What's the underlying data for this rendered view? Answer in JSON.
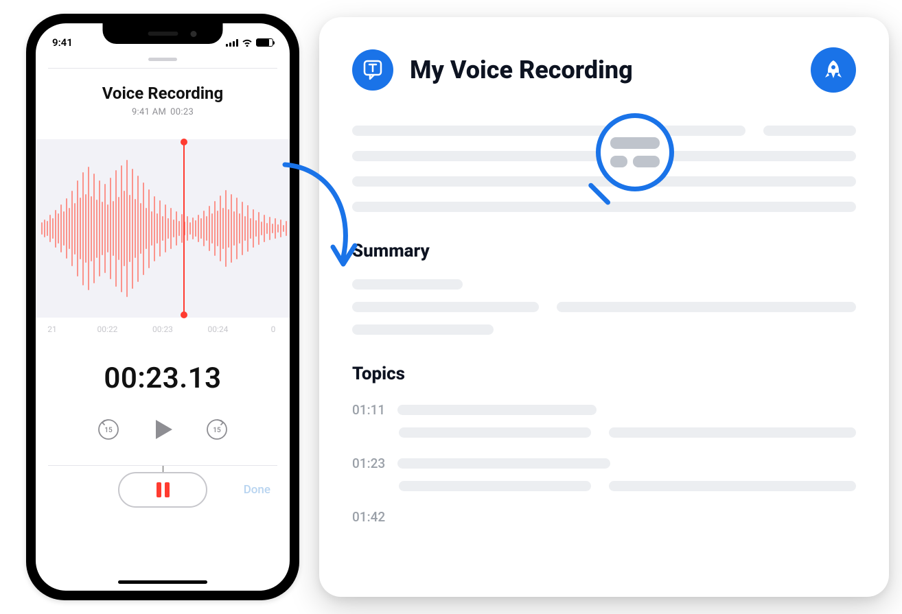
{
  "phone": {
    "status_time": "9:41",
    "title": "Voice Recording",
    "subtitle_time": "9:41 AM",
    "subtitle_duration": "00:23",
    "ticks": [
      "21",
      "00:22",
      "00:23",
      "00:24",
      "0"
    ],
    "timer": "00:23.13",
    "skip_back": "15",
    "skip_fwd": "15",
    "done_label": "Done"
  },
  "card": {
    "title": "My Voice Recording",
    "summary_heading": "Summary",
    "topics_heading": "Topics",
    "topics": [
      {
        "time": "01:11"
      },
      {
        "time": "01:23"
      },
      {
        "time": "01:42"
      }
    ]
  },
  "colors": {
    "accent": "#1a73e8",
    "recording": "#ff3b30"
  }
}
